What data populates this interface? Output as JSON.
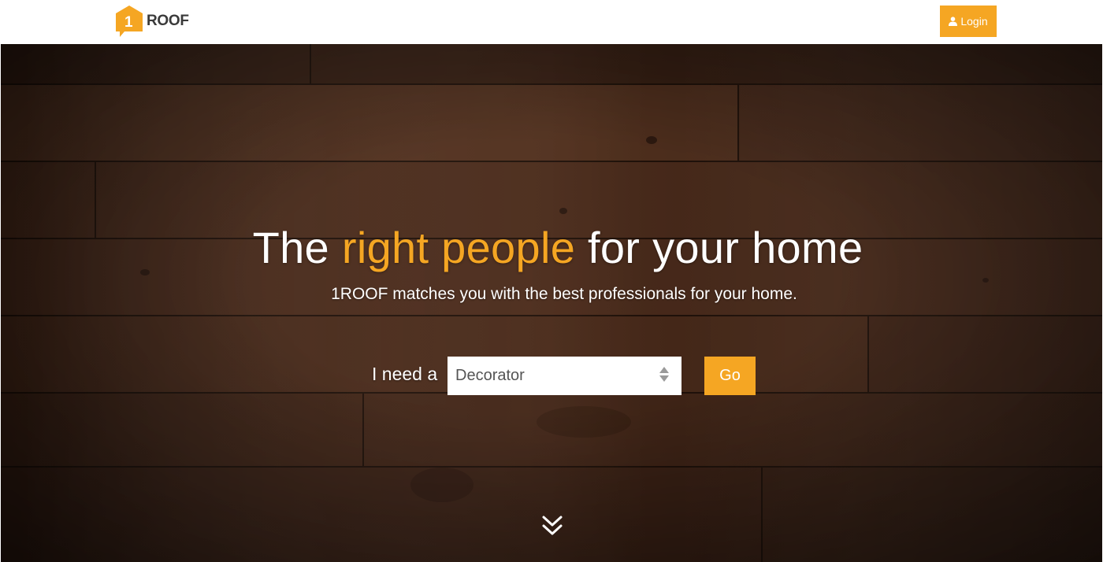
{
  "header": {
    "logo": {
      "mark_text": "1",
      "wordmark": "ROOF"
    },
    "login": {
      "icon": "user-icon",
      "label": "Login"
    }
  },
  "hero": {
    "headline": {
      "before": "The ",
      "accent": "right people",
      "after": " for your home"
    },
    "subheadline": "1ROOF matches you with the best professionals for your home.",
    "search": {
      "label": "I need a",
      "selected_value": "Decorator",
      "go_label": "Go"
    },
    "scroll_icon": "double-chevron-down-icon"
  },
  "colors": {
    "accent": "#f5a623",
    "wordmark": "#3a3a3a",
    "background_wood": "#3b2418"
  }
}
